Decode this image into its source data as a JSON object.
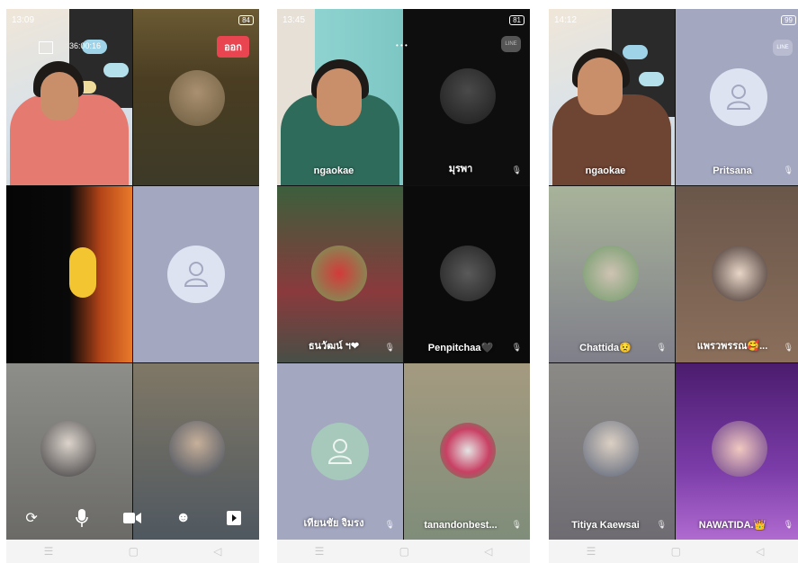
{
  "screen1": {
    "status_time": "13:09",
    "battery": "84",
    "call_timer": "36:00:16",
    "leave_button": "ออก",
    "controls": [
      "switch-camera",
      "microphone",
      "video-camera",
      "effects",
      "screen-share"
    ]
  },
  "screen2": {
    "status_time": "13:45",
    "battery": "81",
    "participants": [
      "ngaokae",
      "มุรพา",
      "ธนวัฒน์ ฯ❤",
      "Penpitchaa🖤",
      "เทียนชัย จิมรง",
      "tanandonbest..."
    ]
  },
  "screen3": {
    "status_time": "14:12",
    "battery": "99",
    "participants": [
      "ngaokae",
      "Pritsana",
      "Chattida😟",
      "แพรวพรรณ🥰...",
      "Titiya Kaewsai",
      "NAWATIDA.👑"
    ]
  },
  "navbar": {
    "menu": "☰",
    "home": "▢",
    "back": "◁"
  },
  "colors": {
    "placeholder_gray": "#a3a7c0",
    "placeholder_green": "#a7c9bc",
    "leave_red": "#e84550"
  }
}
